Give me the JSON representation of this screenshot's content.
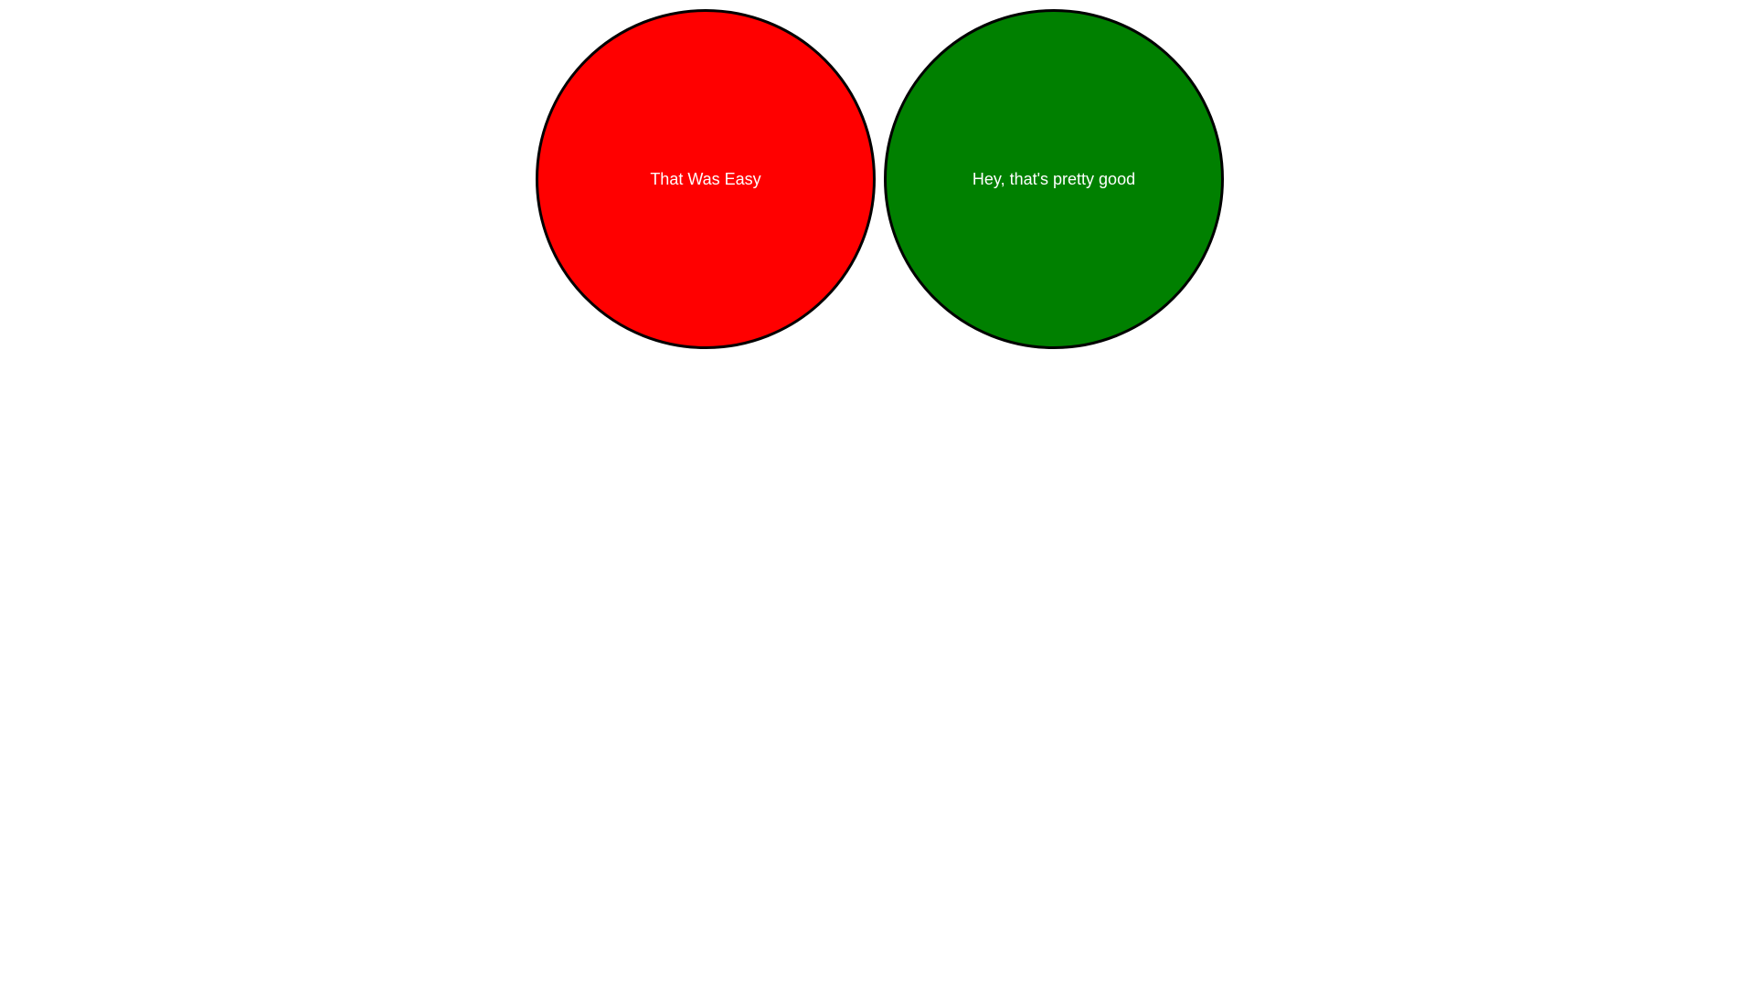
{
  "buttons": {
    "easy": {
      "label": "That Was Easy",
      "color": "#ff0000"
    },
    "good": {
      "label": "Hey, that's pretty good",
      "color": "#008000"
    }
  },
  "colors": {
    "border": "#000000",
    "text": "#ffffff",
    "background": "#ffffff"
  }
}
